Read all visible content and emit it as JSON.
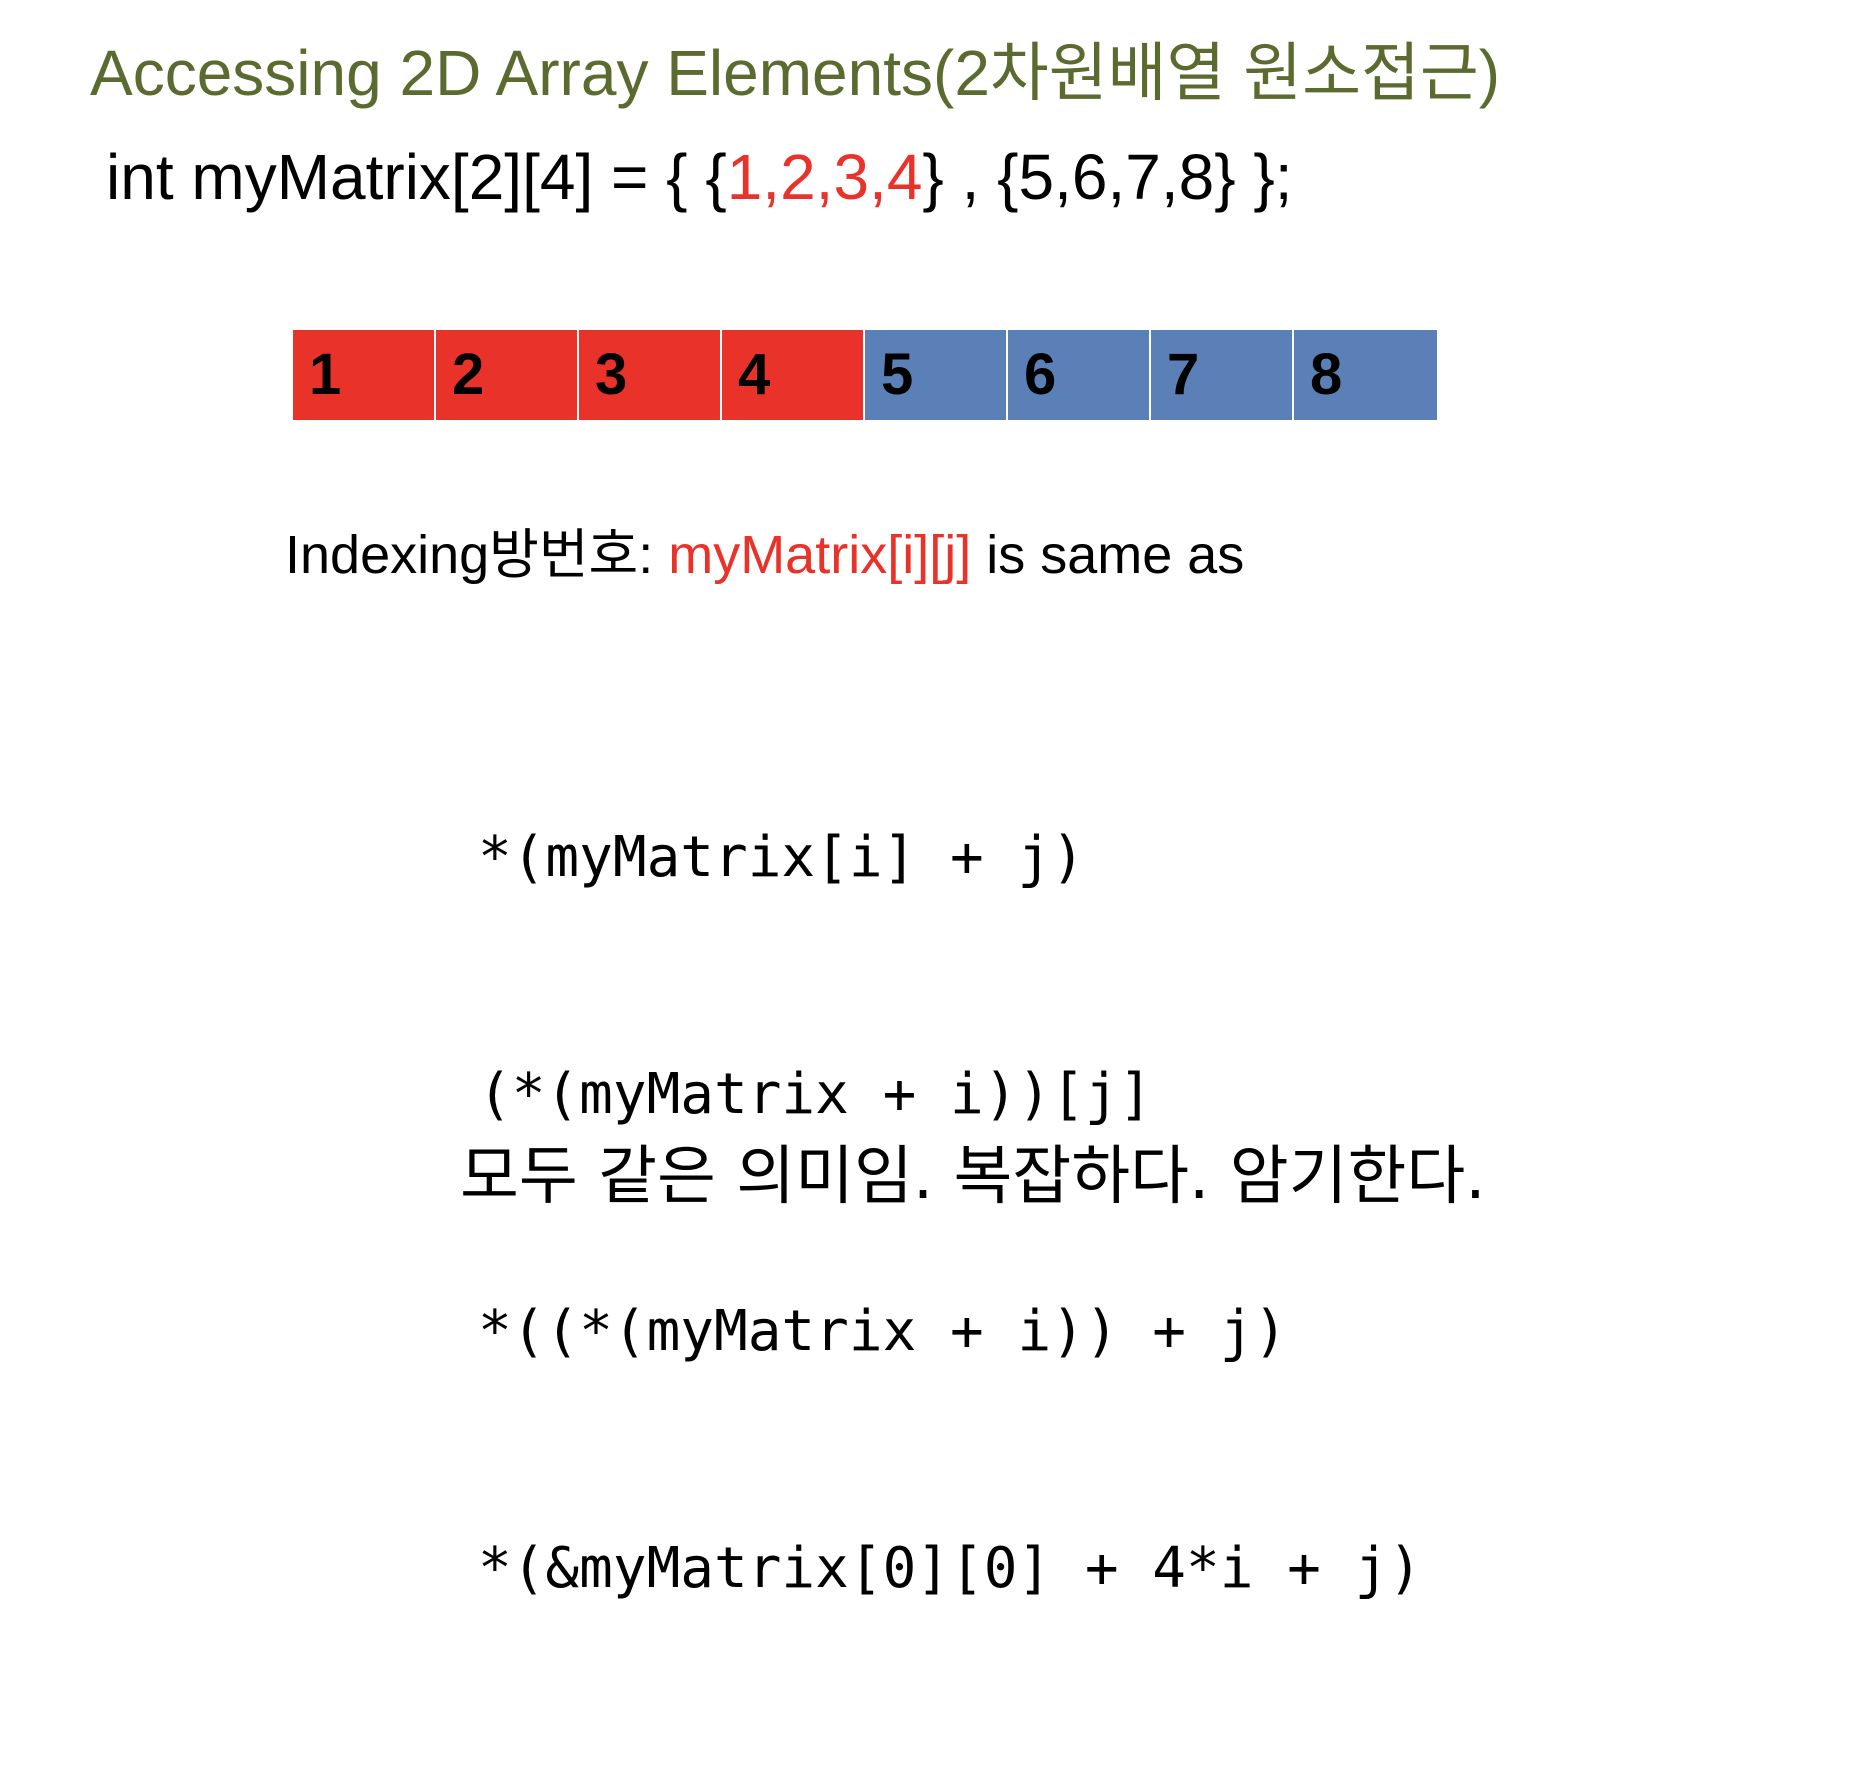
{
  "title": "Accessing 2D Array Elements(2차원배열 원소접근)",
  "declaration": {
    "prefix": "int myMatrix[2][4] = { {",
    "highlight": "1,2,3,4",
    "suffix": "} , {5,6,7,8} };"
  },
  "memory": {
    "cells": [
      {
        "value": "1",
        "row": 0
      },
      {
        "value": "2",
        "row": 0
      },
      {
        "value": "3",
        "row": 0
      },
      {
        "value": "4",
        "row": 0
      },
      {
        "value": "5",
        "row": 1
      },
      {
        "value": "6",
        "row": 1
      },
      {
        "value": "7",
        "row": 1
      },
      {
        "value": "8",
        "row": 1
      }
    ],
    "row_colors": [
      "#e8322a",
      "#5b80b8"
    ]
  },
  "indexing": {
    "label": "Indexing방번호: ",
    "expression": "myMatrix[i][j]",
    "tail": " is same as"
  },
  "code_lines": [
    "*(myMatrix[i] + j)",
    "(*(myMatrix + i))[j]",
    "*((*(myMatrix + i)) + j)",
    "*(&myMatrix[0][0] + 4*i + j)"
  ],
  "footer": "모두 같은 의미임. 복잡하다. 암기한다."
}
